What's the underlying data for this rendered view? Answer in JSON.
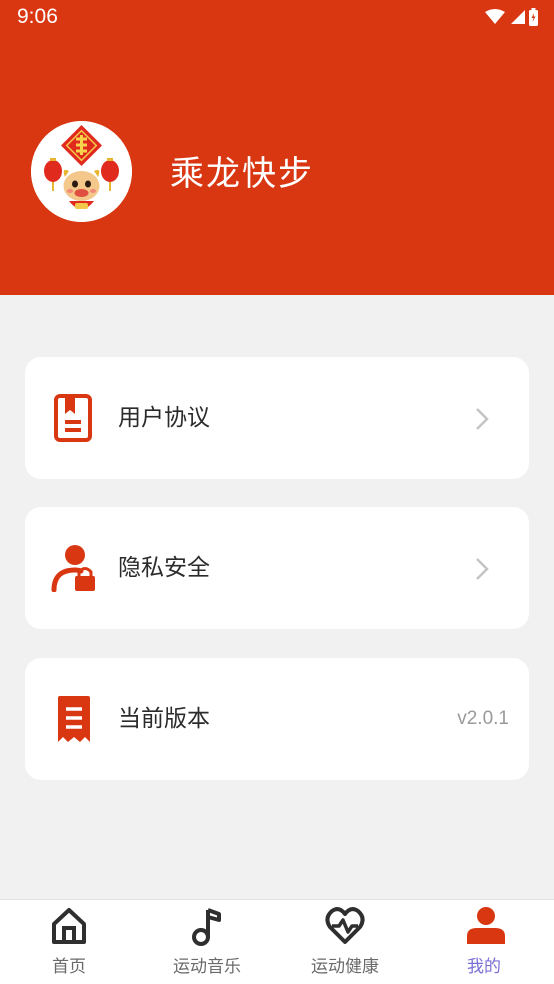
{
  "status_bar": {
    "time": "9:06"
  },
  "profile": {
    "name": "乘龙快步",
    "avatar_icon": "dragon-fortune-avatar"
  },
  "menu": {
    "items": [
      {
        "label": "用户协议",
        "icon": "document-icon",
        "accessory": "chevron-right-icon"
      },
      {
        "label": "隐私安全",
        "icon": "user-lock-icon",
        "accessory": "chevron-right-icon"
      },
      {
        "label": "当前版本",
        "icon": "receipt-icon",
        "value": "v2.0.1"
      }
    ]
  },
  "tabbar": {
    "tabs": [
      {
        "label": "首页",
        "icon": "home-icon",
        "active": false
      },
      {
        "label": "运动音乐",
        "icon": "music-note-icon",
        "active": false
      },
      {
        "label": "运动健康",
        "icon": "heart-pulse-icon",
        "active": false
      },
      {
        "label": "我的",
        "icon": "person-icon",
        "active": true
      }
    ]
  },
  "colors": {
    "brand": "#d93612",
    "active_tab_text": "#7a6fd6",
    "background": "#f1f1f1"
  }
}
